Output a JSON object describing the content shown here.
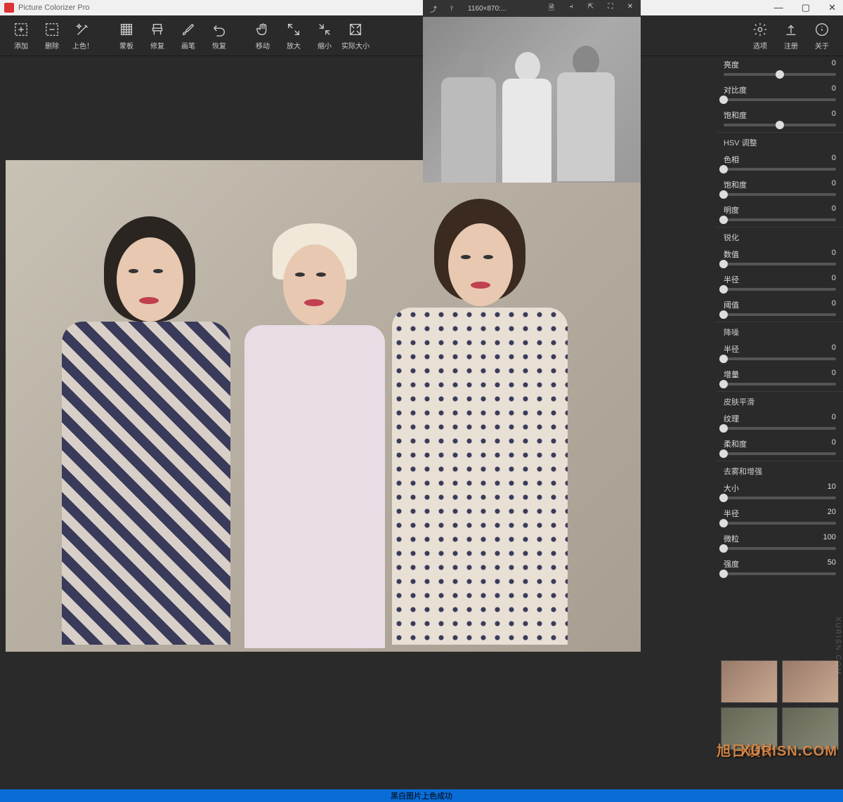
{
  "app": {
    "title": "Picture Colorizer Pro"
  },
  "win": {
    "min": "—",
    "max": "▢",
    "close": "✕"
  },
  "toolbar": {
    "left": [
      {
        "id": "add",
        "label": "添加",
        "icon": "plus-dashed"
      },
      {
        "id": "remove",
        "label": "删除",
        "icon": "minus-dashed"
      },
      {
        "id": "colorize",
        "label": "上色！",
        "icon": "magic"
      },
      {
        "id": "mask",
        "label": "蒙板",
        "icon": "hatch"
      },
      {
        "id": "restore",
        "label": "修复",
        "icon": "chair"
      },
      {
        "id": "brush",
        "label": "画笔",
        "icon": "brush"
      },
      {
        "id": "undo",
        "label": "恢复",
        "icon": "undo"
      },
      {
        "id": "move",
        "label": "移动",
        "icon": "hand"
      },
      {
        "id": "zoomin",
        "label": "放大",
        "icon": "expand"
      },
      {
        "id": "zoomout",
        "label": "缩小",
        "icon": "contract"
      },
      {
        "id": "actual",
        "label": "实际大小",
        "icon": "actual"
      }
    ],
    "right": [
      {
        "id": "options",
        "label": "选项",
        "icon": "gear"
      },
      {
        "id": "register",
        "label": "注册",
        "icon": "upload"
      },
      {
        "id": "about",
        "label": "关于",
        "icon": "info"
      }
    ]
  },
  "preview": {
    "dimensions": "1160×870:...",
    "icons": {
      "pin": "⤴",
      "lock": "⫯",
      "doc": "🗎",
      "fit": "⫞",
      "share": "⇱",
      "full": "⛶",
      "close": "✕"
    }
  },
  "panel": {
    "basic": [
      {
        "key": "brightness",
        "label": "亮度",
        "value": 0,
        "pos": 50
      },
      {
        "key": "contrast",
        "label": "对比度",
        "value": 0,
        "pos": 0
      },
      {
        "key": "saturation",
        "label": "饱和度",
        "value": 0,
        "pos": 50
      }
    ],
    "hsv_title": "HSV 调整",
    "hsv": [
      {
        "key": "hue",
        "label": "色相",
        "value": 0,
        "pos": 0
      },
      {
        "key": "sat2",
        "label": "饱和度",
        "value": 0,
        "pos": 0
      },
      {
        "key": "val",
        "label": "明度",
        "value": 0,
        "pos": 0
      }
    ],
    "sharpen_title": "锐化",
    "sharpen": [
      {
        "key": "amount",
        "label": "数值",
        "value": 0,
        "pos": 0
      },
      {
        "key": "radius",
        "label": "半径",
        "value": 0,
        "pos": 0
      },
      {
        "key": "thresh",
        "label": "阈值",
        "value": 0,
        "pos": 0
      }
    ],
    "denoise_title": "降噪",
    "denoise": [
      {
        "key": "nr_radius",
        "label": "半径",
        "value": 0,
        "pos": 0
      },
      {
        "key": "nr_amount",
        "label": "增量",
        "value": 0,
        "pos": 0
      }
    ],
    "skin_title": "皮肤平滑",
    "skin": [
      {
        "key": "texture",
        "label": "纹理",
        "value": 0,
        "pos": 0
      },
      {
        "key": "soft",
        "label": "柔和度",
        "value": 0,
        "pos": 0
      }
    ],
    "enhance_title": "去雾和增强",
    "enhance": [
      {
        "key": "size",
        "label": "大小",
        "value": 10,
        "pos": 0
      },
      {
        "key": "eradius",
        "label": "半径",
        "value": 20,
        "pos": 0
      },
      {
        "key": "grain",
        "label": "微粒",
        "value": 100,
        "pos": 0
      },
      {
        "key": "strength",
        "label": "强度",
        "value": 50,
        "pos": 0
      }
    ]
  },
  "status": "黑白图片上色成功",
  "watermark": "XURISN.COM",
  "watermark_cn": "旭日设计"
}
